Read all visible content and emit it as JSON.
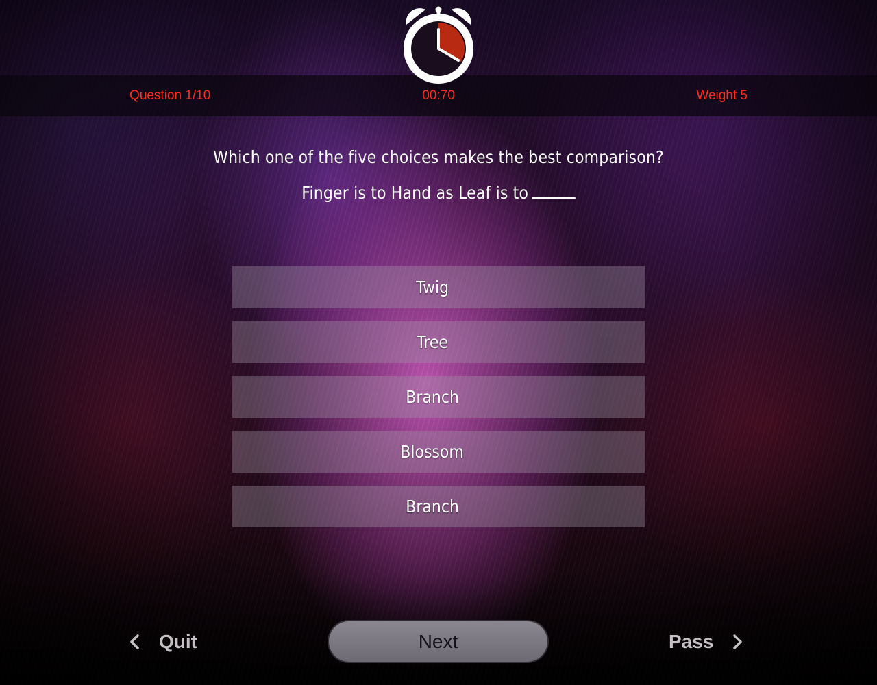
{
  "header": {
    "question_counter": "Question 1/10",
    "timer": "00:70",
    "weight": "Weight 5"
  },
  "clock": {
    "icon": "alarm-clock-icon",
    "ring_color": "#ffffff",
    "elapsed_color": "#b92a12"
  },
  "question": {
    "prompt": "Which one of the five choices makes the best comparison?",
    "analogy": "Finger is to Hand as Leaf is to"
  },
  "choices": [
    {
      "label": "Twig"
    },
    {
      "label": "Tree"
    },
    {
      "label": "Branch"
    },
    {
      "label": "Blossom"
    },
    {
      "label": "Branch"
    }
  ],
  "footer": {
    "quit_label": "Quit",
    "quit_icon": "chevron-left-icon",
    "next_label": "Next",
    "pass_label": "Pass",
    "pass_icon": "chevron-right-icon"
  },
  "colors": {
    "status_text": "#ff2a1a",
    "footer_text": "#c4c0c4"
  }
}
